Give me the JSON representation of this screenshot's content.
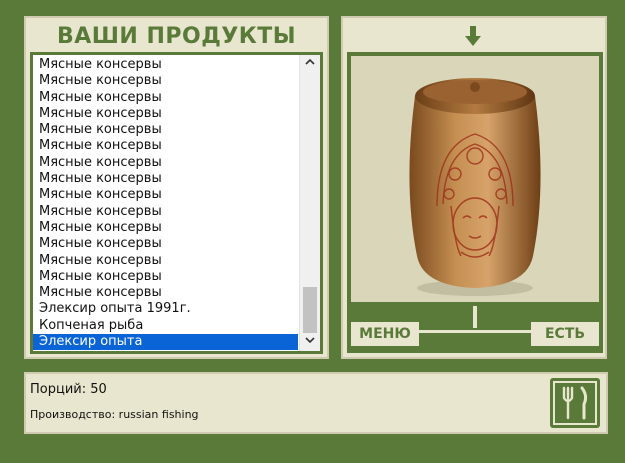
{
  "header": {
    "title": "ВАШИ ПРОДУКТЫ"
  },
  "products": {
    "items": [
      "Мясные консервы",
      "Мясные консервы",
      "Мясные консервы",
      "Мясные консервы",
      "Мясные консервы",
      "Мясные консервы",
      "Мясные консервы",
      "Мясные консервы",
      "Мясные консервы",
      "Мясные консервы",
      "Мясные консервы",
      "Мясные консервы",
      "Мясные консервы",
      "Мясные консервы",
      "Мясные консервы",
      "Элексир опыта 1991г.",
      "Копченая рыба",
      "Элексир опыта"
    ],
    "selected_index": 17
  },
  "buttons": {
    "menu": "МЕНЮ",
    "eat": "ЕСТЬ"
  },
  "info": {
    "portions": "Порций: 50",
    "producer": "Производство: russian fishing"
  },
  "icons": {
    "scroll_up": "chevron-up-icon",
    "scroll_down": "chevron-down-icon",
    "arrow": "arrow-down-icon",
    "eat": "fork-knife-icon",
    "product_image": "decorated-clay-jar"
  },
  "colors": {
    "green": "#5a7a3a",
    "panel": "#e9e6cf",
    "selection": "#0a64d6"
  }
}
